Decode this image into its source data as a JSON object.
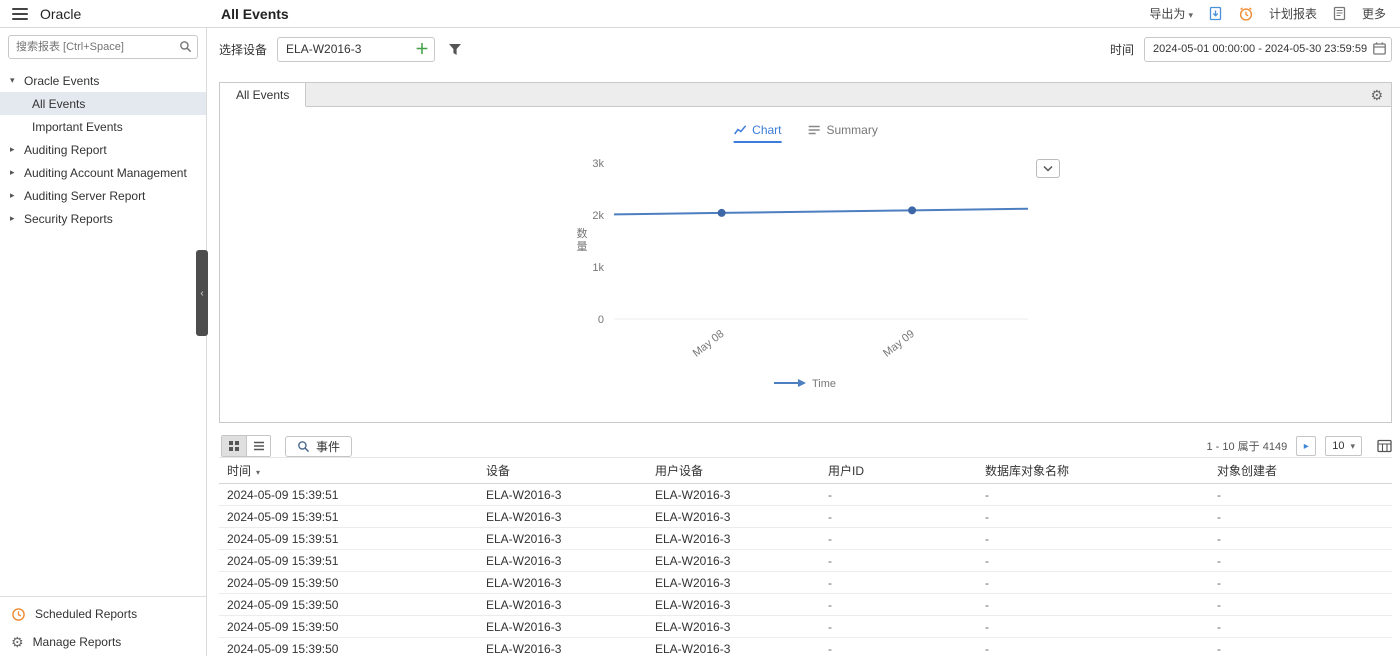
{
  "topbar": {
    "app_title": "Oracle",
    "page_title": "All Events",
    "export_label": "导出为",
    "scheduled_label": "计划报表",
    "more_label": "更多"
  },
  "filters": {
    "device_label": "选择设备",
    "device_value": "ELA-W2016-3",
    "time_label": "时间",
    "time_value": "2024-05-01 00:00:00 - 2024-05-30 23:59:59"
  },
  "sidebar": {
    "search_placeholder": "搜索报表 [Ctrl+Space]",
    "groups": [
      {
        "label": "Oracle Events",
        "expanded": true,
        "children": [
          {
            "label": "All Events",
            "selected": true
          },
          {
            "label": "Important Events",
            "selected": false
          }
        ]
      },
      {
        "label": "Auditing Report",
        "expanded": false
      },
      {
        "label": "Auditing Account Management",
        "expanded": false
      },
      {
        "label": "Auditing Server Report",
        "expanded": false
      },
      {
        "label": "Security Reports",
        "expanded": false
      }
    ],
    "footer_items": [
      {
        "label": "Scheduled Reports",
        "icon": "clock-icon"
      },
      {
        "label": "Manage Reports",
        "icon": "gear-icon"
      }
    ]
  },
  "main": {
    "active_tab": "All Events",
    "view_tabs": [
      {
        "label": "Chart",
        "active": true
      },
      {
        "label": "Summary",
        "active": false
      }
    ]
  },
  "chart_data": {
    "type": "line",
    "x": [
      "May 08",
      "May 09"
    ],
    "x_frac": [
      0.26,
      0.72
    ],
    "values": [
      2040,
      2090
    ],
    "ylabel": "数量",
    "ylim": [
      0,
      3000
    ],
    "yticks": [
      {
        "label": "3k",
        "value": 3000
      },
      {
        "label": "2k",
        "value": 2000
      },
      {
        "label": "1k",
        "value": 1000
      },
      {
        "label": "0",
        "value": 0
      }
    ],
    "legend": "Time",
    "legend_position": "bottom-center",
    "grid": false,
    "line_color": "#4d7ebf",
    "point_color": "#3e67a8"
  },
  "toolbar": {
    "event_button_label": "事件",
    "pagination_text": "1 - 10 属于 4149",
    "page_size": "10"
  },
  "table": {
    "columns": [
      {
        "label": "时间",
        "sortable": true
      },
      {
        "label": "设备"
      },
      {
        "label": "用户设备"
      },
      {
        "label": "用户ID"
      },
      {
        "label": "数据库对象名称"
      },
      {
        "label": "对象创建者"
      }
    ],
    "rows": [
      [
        "2024-05-09 15:39:51",
        "ELA-W2016-3",
        "ELA-W2016-3",
        "-",
        "-",
        "-"
      ],
      [
        "2024-05-09 15:39:51",
        "ELA-W2016-3",
        "ELA-W2016-3",
        "-",
        "-",
        "-"
      ],
      [
        "2024-05-09 15:39:51",
        "ELA-W2016-3",
        "ELA-W2016-3",
        "-",
        "-",
        "-"
      ],
      [
        "2024-05-09 15:39:51",
        "ELA-W2016-3",
        "ELA-W2016-3",
        "-",
        "-",
        "-"
      ],
      [
        "2024-05-09 15:39:50",
        "ELA-W2016-3",
        "ELA-W2016-3",
        "-",
        "-",
        "-"
      ],
      [
        "2024-05-09 15:39:50",
        "ELA-W2016-3",
        "ELA-W2016-3",
        "-",
        "-",
        "-"
      ],
      [
        "2024-05-09 15:39:50",
        "ELA-W2016-3",
        "ELA-W2016-3",
        "-",
        "-",
        "-"
      ],
      [
        "2024-05-09 15:39:50",
        "ELA-W2016-3",
        "ELA-W2016-3",
        "-",
        "-",
        "-"
      ]
    ]
  }
}
